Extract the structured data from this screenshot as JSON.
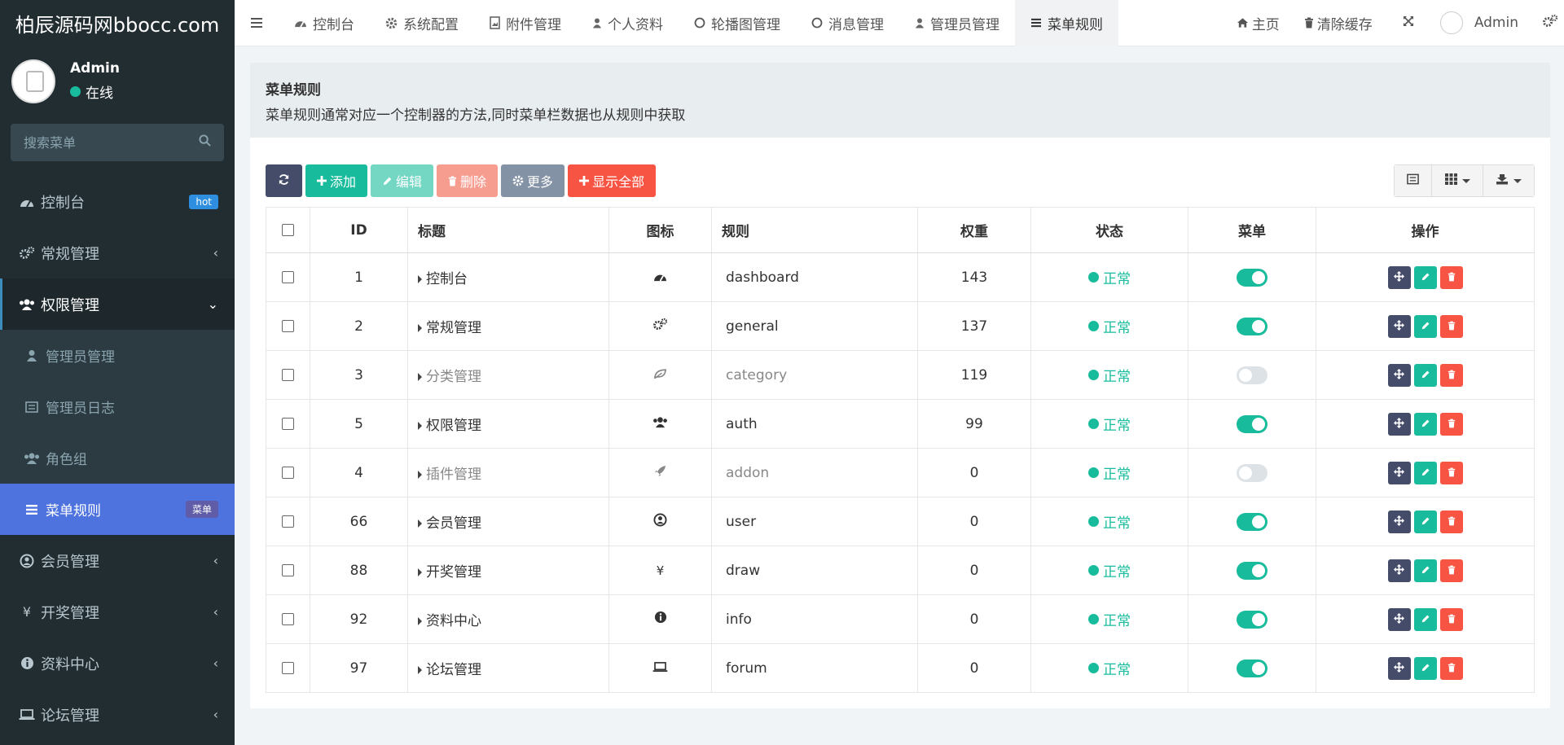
{
  "sidebar": {
    "logo": "柏辰源码网bbocc.com",
    "user": {
      "name": "Admin",
      "status": "在线"
    },
    "search_placeholder": "搜索菜单",
    "menu": [
      {
        "label": "控制台",
        "icon": "dashboard-icon",
        "badge": "hot"
      },
      {
        "label": "常规管理",
        "icon": "cogs-icon"
      },
      {
        "label": "权限管理",
        "icon": "users-icon",
        "open": true
      }
    ],
    "submenu": [
      {
        "label": "管理员管理",
        "icon": "user-icon"
      },
      {
        "label": "管理员日志",
        "icon": "list-alt-icon"
      },
      {
        "label": "角色组",
        "icon": "group-icon"
      },
      {
        "label": "菜单规则",
        "icon": "bars-icon",
        "badge": "菜单",
        "active": true
      }
    ],
    "menu_after": [
      {
        "label": "会员管理",
        "icon": "user-circle-icon"
      },
      {
        "label": "开奖管理",
        "icon": "yen-icon"
      },
      {
        "label": "资料中心",
        "icon": "info-circle-icon"
      },
      {
        "label": "论坛管理",
        "icon": "laptop-icon"
      }
    ]
  },
  "topnav": {
    "tabs": [
      "控制台",
      "系统配置",
      "附件管理",
      "个人资料",
      "轮播图管理",
      "消息管理",
      "管理员管理",
      "菜单规则"
    ],
    "active_tab": "菜单规则",
    "right": {
      "home": "主页",
      "clear_cache": "清除缓存",
      "user": "Admin"
    }
  },
  "panel": {
    "title": "菜单规则",
    "description": "菜单规则通常对应一个控制器的方法,同时菜单栏数据也从规则中获取"
  },
  "toolbar": {
    "add": "添加",
    "edit": "编辑",
    "delete": "删除",
    "more": "更多",
    "show_all": "显示全部"
  },
  "table": {
    "headers": {
      "id": "ID",
      "title": "标题",
      "icon": "图标",
      "rule": "规则",
      "weight": "权重",
      "status": "状态",
      "menu": "菜单",
      "ops": "操作"
    },
    "rows": [
      {
        "id": "1",
        "title": "控制台",
        "icon": "dashboard-icon",
        "rule": "dashboard",
        "weight": "143",
        "status": "正常",
        "menu": true
      },
      {
        "id": "2",
        "title": "常规管理",
        "icon": "cogs-icon",
        "rule": "general",
        "weight": "137",
        "status": "正常",
        "menu": true
      },
      {
        "id": "3",
        "title": "分类管理",
        "icon": "leaf-icon",
        "rule": "category",
        "weight": "119",
        "status": "正常",
        "menu": false
      },
      {
        "id": "5",
        "title": "权限管理",
        "icon": "users-icon",
        "rule": "auth",
        "weight": "99",
        "status": "正常",
        "menu": true
      },
      {
        "id": "4",
        "title": "插件管理",
        "icon": "rocket-icon",
        "rule": "addon",
        "weight": "0",
        "status": "正常",
        "menu": false
      },
      {
        "id": "66",
        "title": "会员管理",
        "icon": "user-circle-icon",
        "rule": "user",
        "weight": "0",
        "status": "正常",
        "menu": true
      },
      {
        "id": "88",
        "title": "开奖管理",
        "icon": "yen-icon",
        "rule": "draw",
        "weight": "0",
        "status": "正常",
        "menu": true
      },
      {
        "id": "92",
        "title": "资料中心",
        "icon": "info-circle-icon",
        "rule": "info",
        "weight": "0",
        "status": "正常",
        "menu": true
      },
      {
        "id": "97",
        "title": "论坛管理",
        "icon": "laptop-icon",
        "rule": "forum",
        "weight": "0",
        "status": "正常",
        "menu": true
      }
    ]
  },
  "colors": {
    "accent": "#18bc9c",
    "sidebar_bg": "#222d32",
    "active_item": "#4e73df",
    "danger": "#f75444",
    "dark_btn": "#444c69"
  }
}
